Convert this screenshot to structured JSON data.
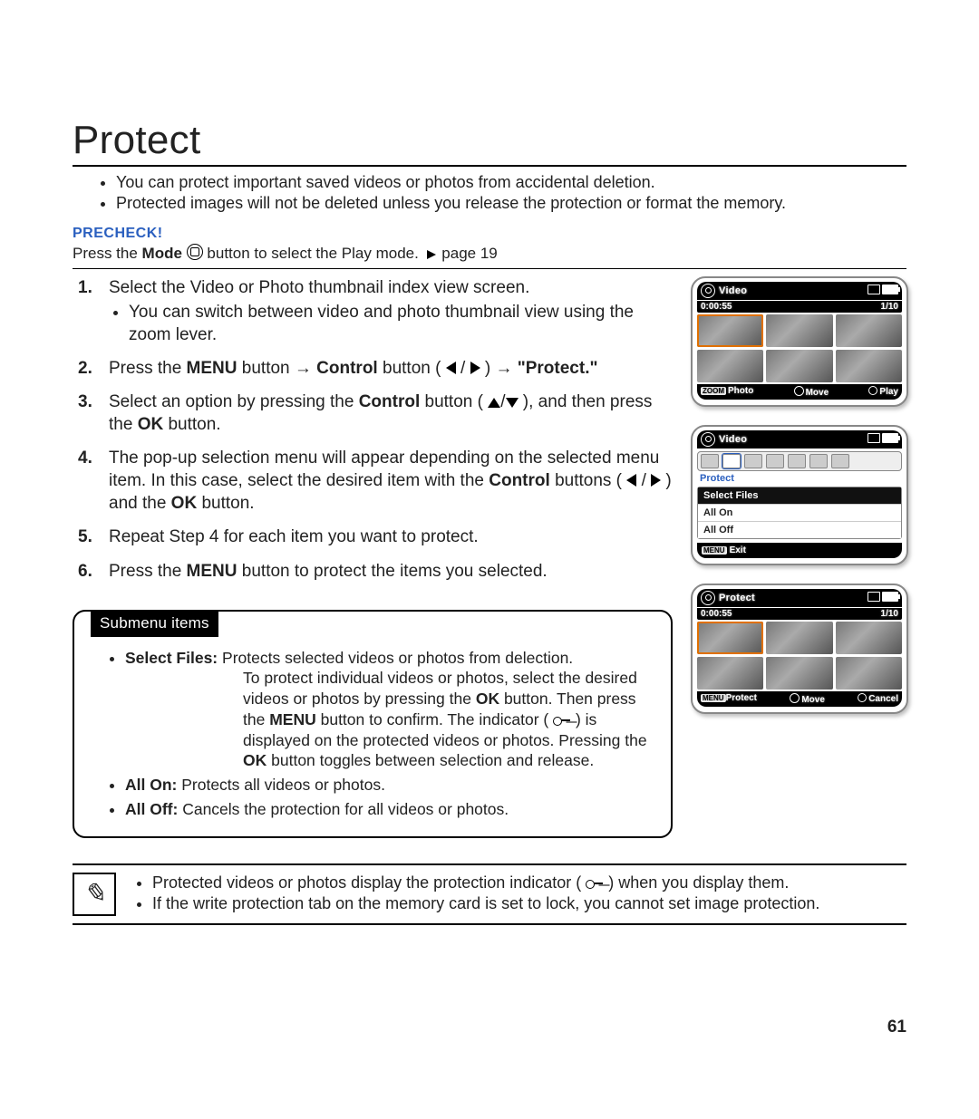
{
  "title": "Protect",
  "intro_bullets": [
    "You can protect important saved videos or photos from accidental deletion.",
    "Protected images will not be deleted unless you release the protection or format the memory."
  ],
  "precheck": {
    "label": "PRECHECK!",
    "prefix": "Press the ",
    "mode": "Mode",
    "suffix": " button to select the Play mode. ",
    "pageref": "page 19"
  },
  "steps": {
    "s1": {
      "text": "Select the Video or Photo thumbnail index view screen.",
      "sub": "You can switch between video and photo thumbnail view using the zoom lever."
    },
    "s2": {
      "a": "Press the ",
      "menu": "MENU",
      "b": " button → ",
      "control": "Control",
      "c": " button (",
      "d": ") → ",
      "protect": "\"Protect.\""
    },
    "s3": {
      "a": "Select an option by pressing the ",
      "control": "Control",
      "b": " button (",
      "c": "), and then press the ",
      "ok": "OK",
      "d": " button."
    },
    "s4": {
      "a": "The pop-up selection menu will appear depending on the selected menu item. In this case, select the desired item with the ",
      "control": "Control",
      "b": " buttons (",
      "c": ") and the ",
      "ok": "OK",
      "d": " button."
    },
    "s5": "Repeat Step 4 for each item you want to protect.",
    "s6": {
      "a": "Press the ",
      "menu": "MENU",
      "b": " button to protect the items you selected."
    }
  },
  "submenu": {
    "tab": "Submenu items",
    "sf_label": "Select Files:",
    "sf_text1": " Protects selected videos or photos from delection.",
    "sf_cont_a": "To protect individual videos or photos, select the desired videos or photos by pressing the ",
    "ok": "OK",
    "sf_cont_b": " button. Then press the ",
    "menu": "MENU",
    "sf_cont_c": " button to confirm. The indicator ( ",
    "sf_cont_d": " ) is displayed on the protected videos or photos. Pressing the ",
    "sf_cont_e": " button toggles between selection and release.",
    "allon_label": "All On:",
    "allon_text": " Protects all videos or photos.",
    "alloff_label": "All Off:",
    "alloff_text": " Cancels the protection for all videos or photos."
  },
  "notes": {
    "n1a": "Protected videos or photos display the protection indicator ( ",
    "n1b": " ) when you display them.",
    "n2": "If the write protection tab on the memory card is set to lock, you cannot set image protection."
  },
  "page_number": "61",
  "screens": {
    "s1": {
      "header": "Video",
      "time": "0:00:55",
      "count": "1/10",
      "foot_photo": "Photo",
      "foot_move": "Move",
      "foot_play": "Play"
    },
    "s2": {
      "header": "Video",
      "protect_label": "Protect",
      "opt1": "Select Files",
      "opt2": "All On",
      "opt3": "All Off",
      "exit": "Exit"
    },
    "s3": {
      "header": "Protect",
      "time": "0:00:55",
      "count": "1/10",
      "foot_protect": "Protect",
      "foot_move": "Move",
      "foot_cancel": "Cancel"
    }
  }
}
